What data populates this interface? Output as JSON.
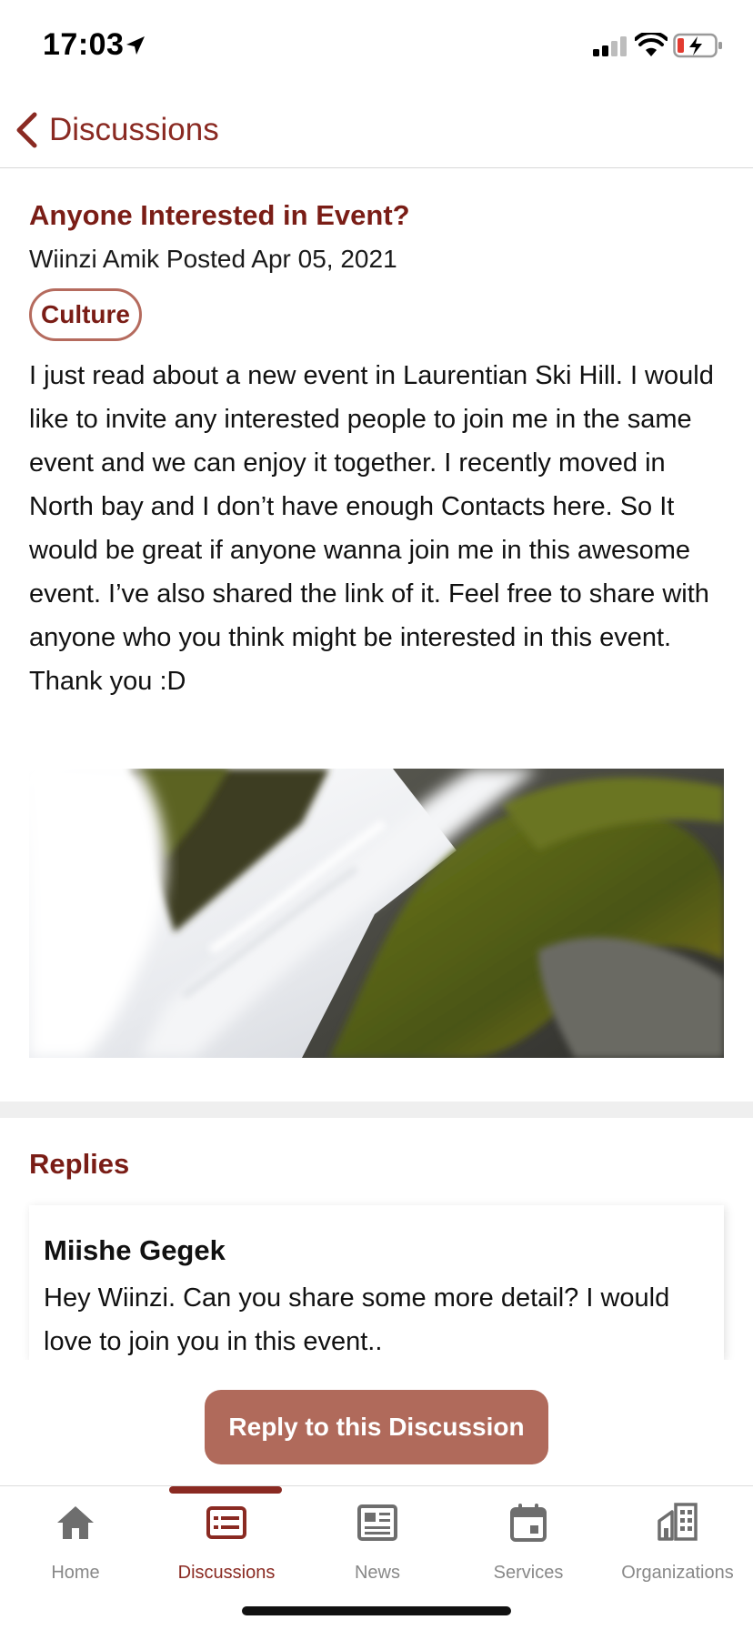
{
  "status_bar": {
    "time": "17:03"
  },
  "nav": {
    "back_label": "Discussions"
  },
  "post": {
    "title": "Anyone Interested in Event?",
    "meta": "Wiinzi Amik Posted Apr 05, 2021",
    "category": "Culture",
    "body": "I just read about a new event in Laurentian Ski Hill. I would like to invite any interested people to join me in the same event and we can enjoy it together. I recently moved in North bay and I don’t have enough Contacts here. So It would be great if anyone wanna join me in this awesome event. I’ve also shared the link of it. Feel free to share with anyone who you think might be interested in this event. Thank you :D"
  },
  "replies": {
    "title": "Replies",
    "items": [
      {
        "author": "Miishe Gegek",
        "text": "Hey Wiinzi. Can you share some more detail? I would love to join you in this event.."
      }
    ]
  },
  "actions": {
    "reply_button": "Reply to this Discussion"
  },
  "tab_bar": {
    "items": [
      {
        "label": "Home",
        "icon": "home-icon",
        "active": false
      },
      {
        "label": "Discussions",
        "icon": "discussions-icon",
        "active": true
      },
      {
        "label": "News",
        "icon": "news-icon",
        "active": false
      },
      {
        "label": "Services",
        "icon": "calendar-icon",
        "active": false
      },
      {
        "label": "Organizations",
        "icon": "buildings-icon",
        "active": false
      }
    ]
  },
  "colors": {
    "accent": "#8a2a22",
    "title": "#7a1d16",
    "button": "#b06a5b",
    "badge_border": "#b56b5e",
    "inactive_tab": "#888888"
  }
}
